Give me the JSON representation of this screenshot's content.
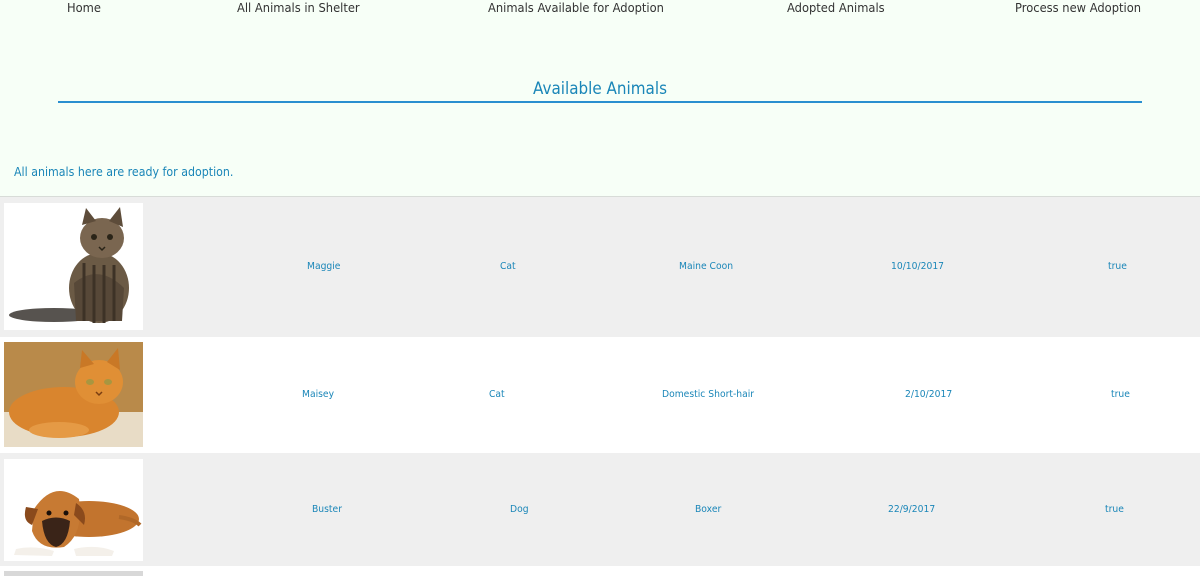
{
  "nav": {
    "home": "Home",
    "all_animals": "All Animals in Shelter",
    "available": "Animals Available for Adoption",
    "adopted": "Adopted Animals",
    "process": "Process new Adoption"
  },
  "page": {
    "title": "Available Animals",
    "intro": "All animals here are ready for adoption."
  },
  "animals": [
    {
      "name": "Maggie",
      "species": "Cat",
      "breed": "Maine Coon",
      "date": "10/10/2017",
      "available": "true",
      "photo": "tabby-kitten-photo"
    },
    {
      "name": "Maisey",
      "species": "Cat",
      "breed": "Domestic Short-hair",
      "date": "2/10/2017",
      "available": "true",
      "photo": "orange-cat-photo"
    },
    {
      "name": "Buster",
      "species": "Dog",
      "breed": "Boxer",
      "date": "22/9/2017",
      "available": "true",
      "photo": "boxer-dog-photo"
    }
  ],
  "colors": {
    "background": "#f7fff7",
    "accent": "#1a86b8",
    "row_shaded": "#efefef",
    "row_plain": "#ffffff"
  }
}
